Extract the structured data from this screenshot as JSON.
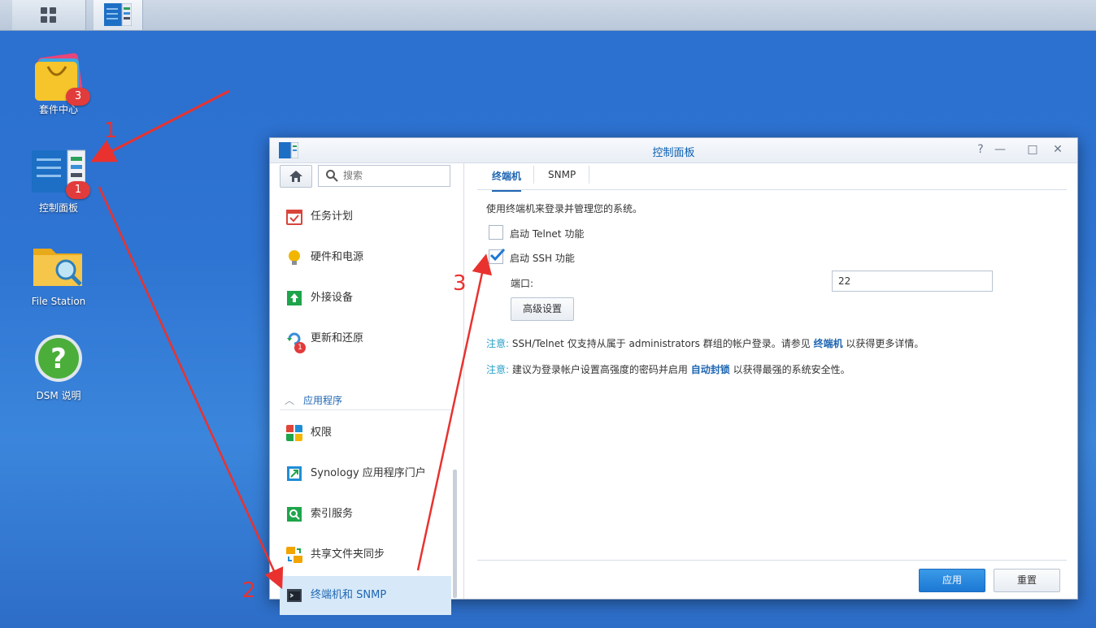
{
  "taskbar": {
    "main_icon": "grid-icon",
    "cp_icon": "control-panel-icon"
  },
  "desktop": {
    "package_center": {
      "label": "套件中心",
      "badge": "3"
    },
    "control_panel": {
      "label": "控制面板",
      "badge": "1"
    },
    "file_station": {
      "label": "File Station"
    },
    "dsm_help": {
      "label": "DSM 说明"
    }
  },
  "window": {
    "title": "控制面板",
    "controls": {
      "help": "?",
      "minimize": "—",
      "maximize": "□",
      "close": "✕"
    },
    "search_placeholder": "搜索",
    "sidebar": {
      "items": [
        {
          "label": "任务计划",
          "icon": "calendar-icon",
          "color": "#d9443b"
        },
        {
          "label": "硬件和电源",
          "icon": "bulb-icon",
          "color": "#f2b600"
        },
        {
          "label": "外接设备",
          "icon": "upload-icon",
          "color": "#1ea54b"
        },
        {
          "label": "更新和还原",
          "icon": "refresh-icon",
          "color": "#3a8fd8",
          "badge": "1"
        }
      ],
      "section_label": "应用程序",
      "app_items": [
        {
          "label": "权限",
          "icon": "permission-icon",
          "color": "#e0453a"
        },
        {
          "label": "Synology 应用程序门户",
          "icon": "portal-icon",
          "color": "#1f8dd6"
        },
        {
          "label": "索引服务",
          "icon": "index-icon",
          "color": "#1ea54b"
        },
        {
          "label": "共享文件夹同步",
          "icon": "sync-icon",
          "color": "#f2a400"
        },
        {
          "label": "终端机和 SNMP",
          "icon": "terminal-icon",
          "color": "#3a4450"
        }
      ]
    },
    "tabs": [
      "终端机",
      "SNMP"
    ],
    "intro": "使用终端机来登录并管理您的系统。",
    "telnet_label": "启动 Telnet 功能",
    "ssh_label": "启动 SSH 功能",
    "telnet_checked": false,
    "ssh_checked": true,
    "port_label": "端口:",
    "port_value": "22",
    "advanced_button": "高级设置",
    "note1": {
      "label": "注意:",
      "pre": "SSH/Telnet 仅支持从属于 administrators 群组的帐户登录。请参见",
      "link": "终端机",
      "post": "以获得更多详情。"
    },
    "note2": {
      "label": "注意:",
      "pre": "建议为登录帐户设置高强度的密码并启用",
      "link": "自动封锁",
      "post": "以获得最强的系统安全性。"
    },
    "apply_button": "应用",
    "reset_button": "重置"
  },
  "annotations": {
    "step1": "1",
    "step2": "2",
    "step3": "3",
    "color": "#e9322f"
  }
}
